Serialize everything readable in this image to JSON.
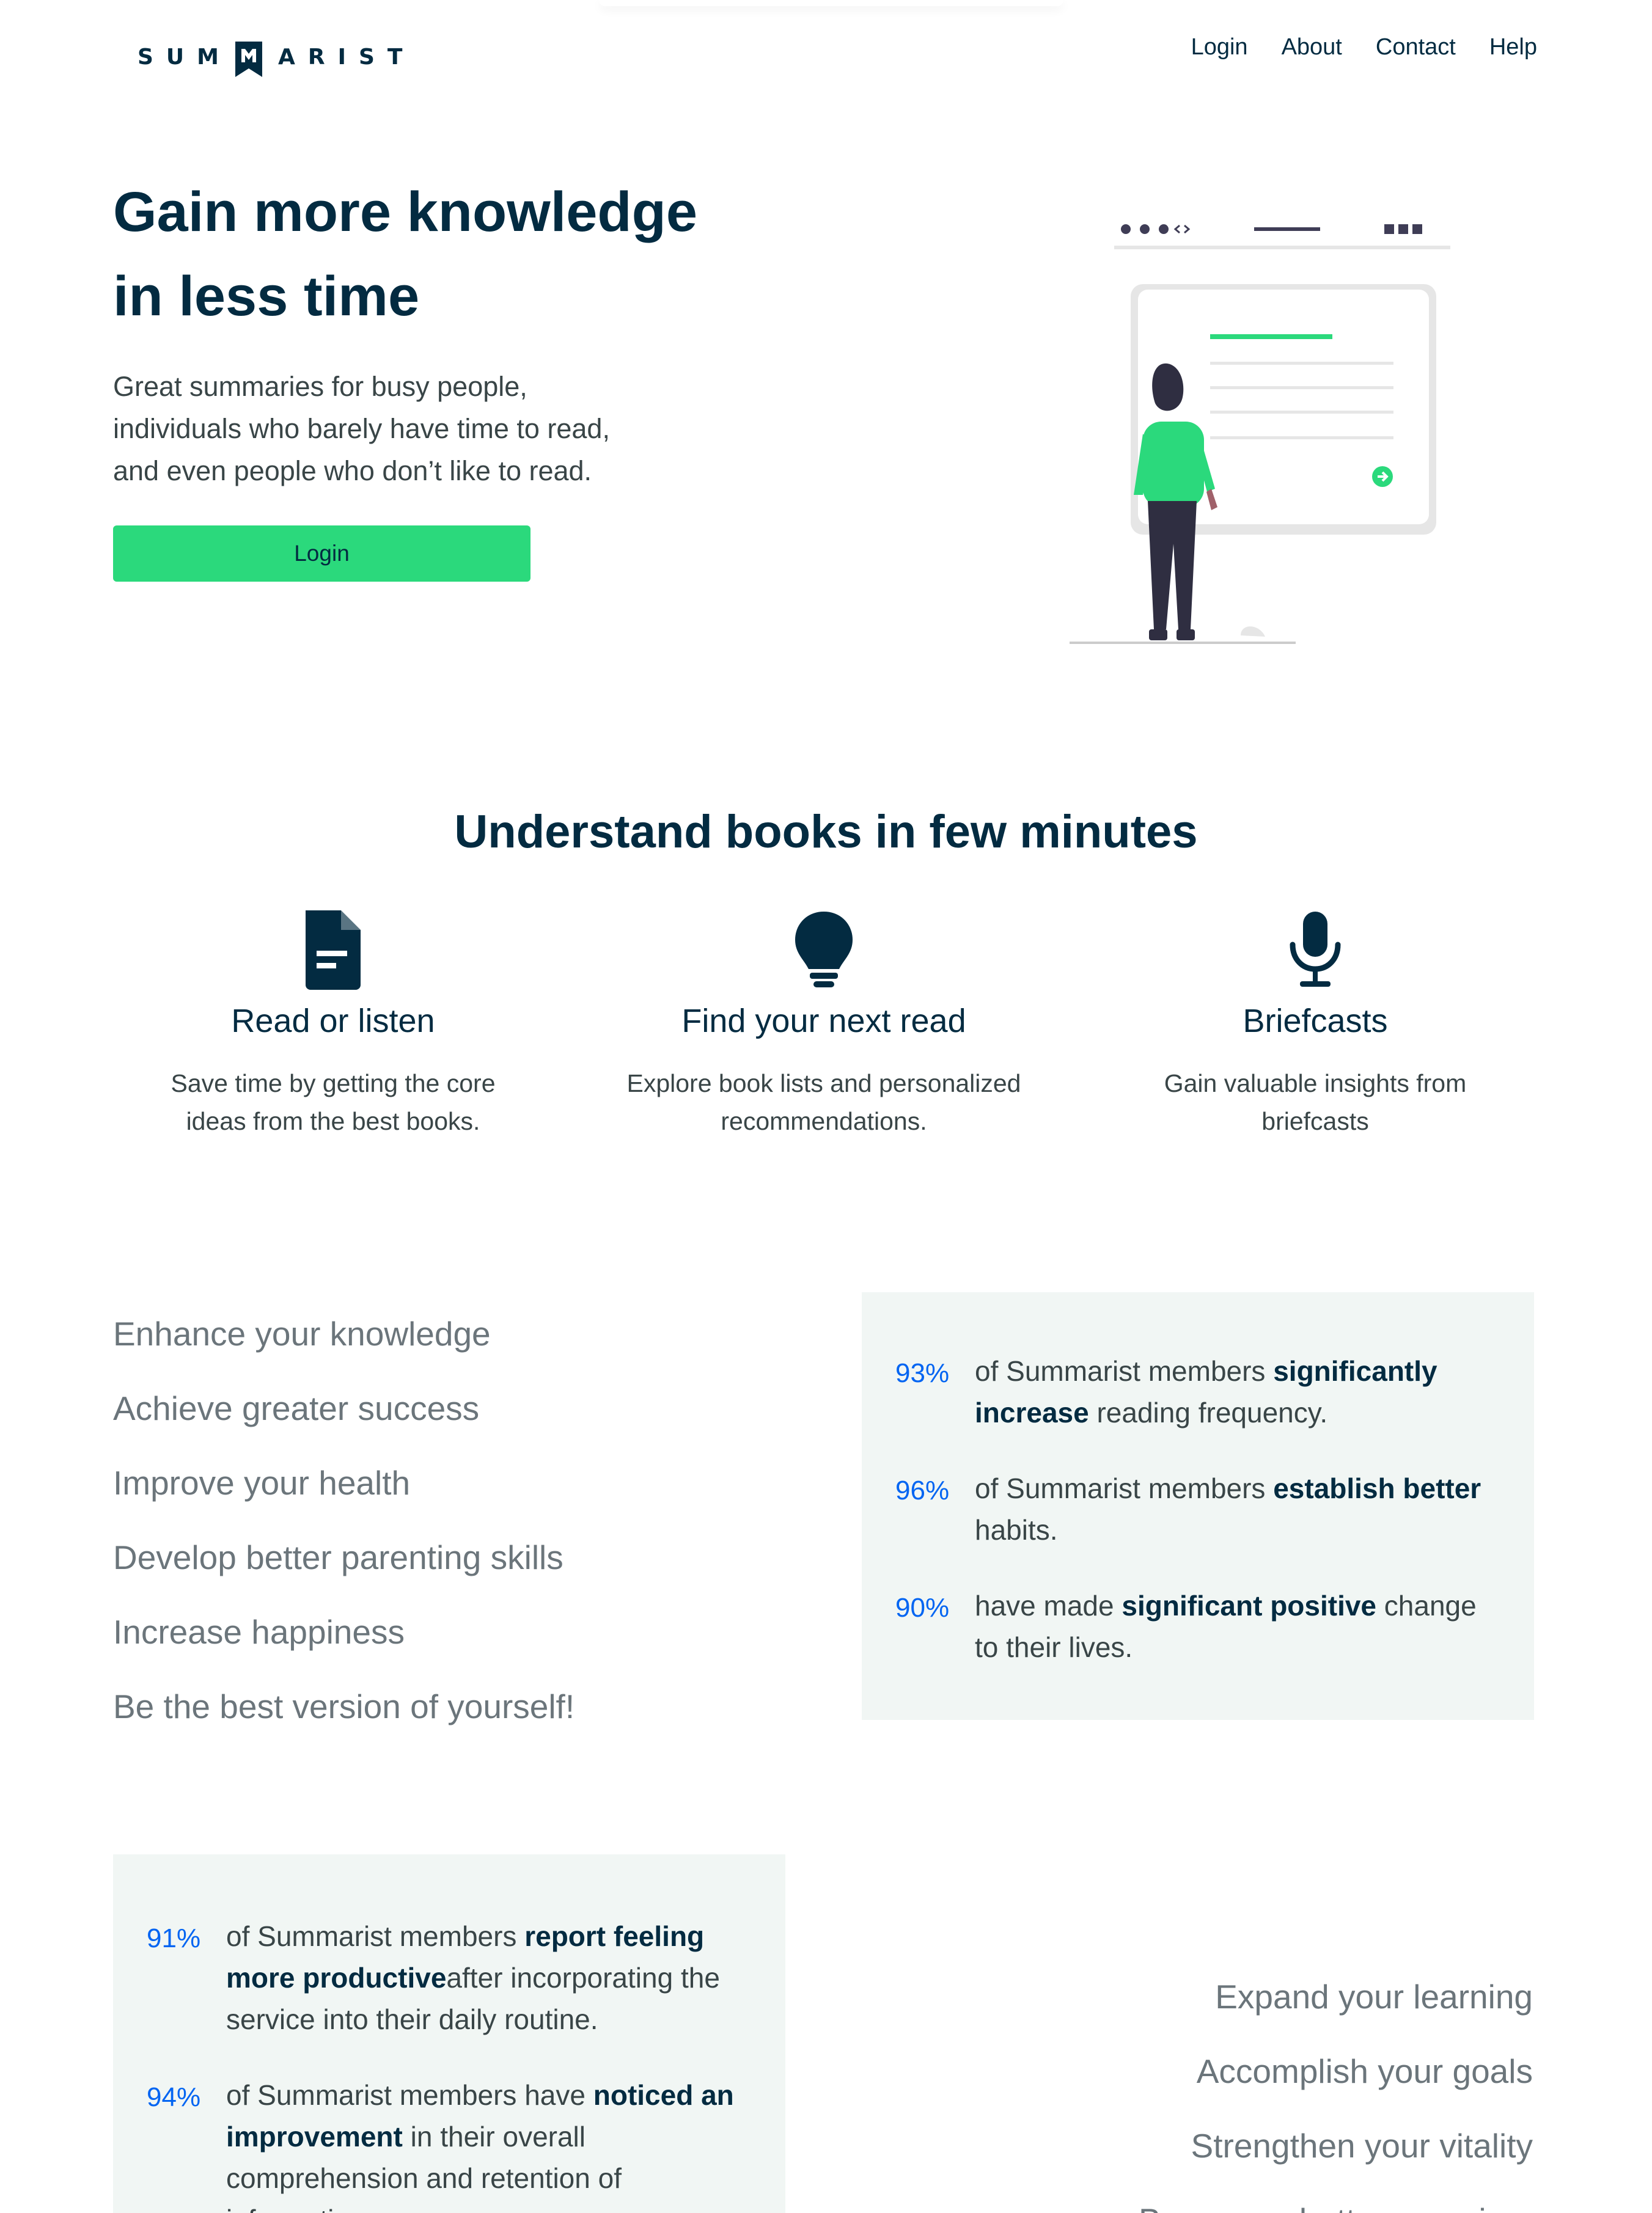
{
  "nav": {
    "logo_text_left": "SUM",
    "logo_text_right": "ARIST",
    "links": [
      "Login",
      "About",
      "Contact",
      "Help"
    ]
  },
  "hero": {
    "title_line1": "Gain more knowledge",
    "title_line2": "in less time",
    "subtitle_line1": "Great summaries for busy people,",
    "subtitle_line2": "individuals who barely have time to read,",
    "subtitle_line3": "and even people who don’t like to read.",
    "login_button": "Login"
  },
  "features": {
    "title": "Understand books in few minutes",
    "items": [
      {
        "icon": "document-icon",
        "title": "Read or listen",
        "desc_line1": "Save time by getting the core",
        "desc_line2": "ideas from the best books."
      },
      {
        "icon": "lightbulb-icon",
        "title": "Find your next read",
        "desc_line1": "Explore book lists and personalized",
        "desc_line2": "recommendations."
      },
      {
        "icon": "microphone-icon",
        "title": "Briefcasts",
        "desc_line1": "Gain valuable insights from",
        "desc_line2": "briefcasts"
      }
    ]
  },
  "stats_section_1": {
    "headings": [
      "Enhance your knowledge",
      "Achieve greater success",
      "Improve your health",
      "Develop better parenting skills",
      "Increase happiness",
      "Be the best version of yourself!"
    ],
    "stats": [
      {
        "num": "93%",
        "pre": "of Summarist members ",
        "bold": "significantly increase",
        "post": " reading frequency."
      },
      {
        "num": "96%",
        "pre": "of Summarist members ",
        "bold": "establish better",
        "post": " habits."
      },
      {
        "num": "90%",
        "pre": "have made ",
        "bold": "significant positive",
        "post": " change to their lives."
      }
    ]
  },
  "stats_section_2": {
    "headings": [
      "Expand your learning",
      "Accomplish your goals",
      "Strengthen your vitality",
      "Become a better caregiver"
    ],
    "stats": [
      {
        "num": "91%",
        "pre": "of Summarist members ",
        "bold": "report feeling more productive",
        "post": "after incorporating the service into their daily routine."
      },
      {
        "num": "94%",
        "pre": "of Summarist members have ",
        "bold": "noticed an improvement",
        "post": " in their overall comprehension and retention of information."
      }
    ]
  },
  "colors": {
    "brand": "#032b41",
    "accent": "#2bd97c",
    "stat_blue": "#0365f2",
    "stats_bg": "#f1f6f4"
  }
}
